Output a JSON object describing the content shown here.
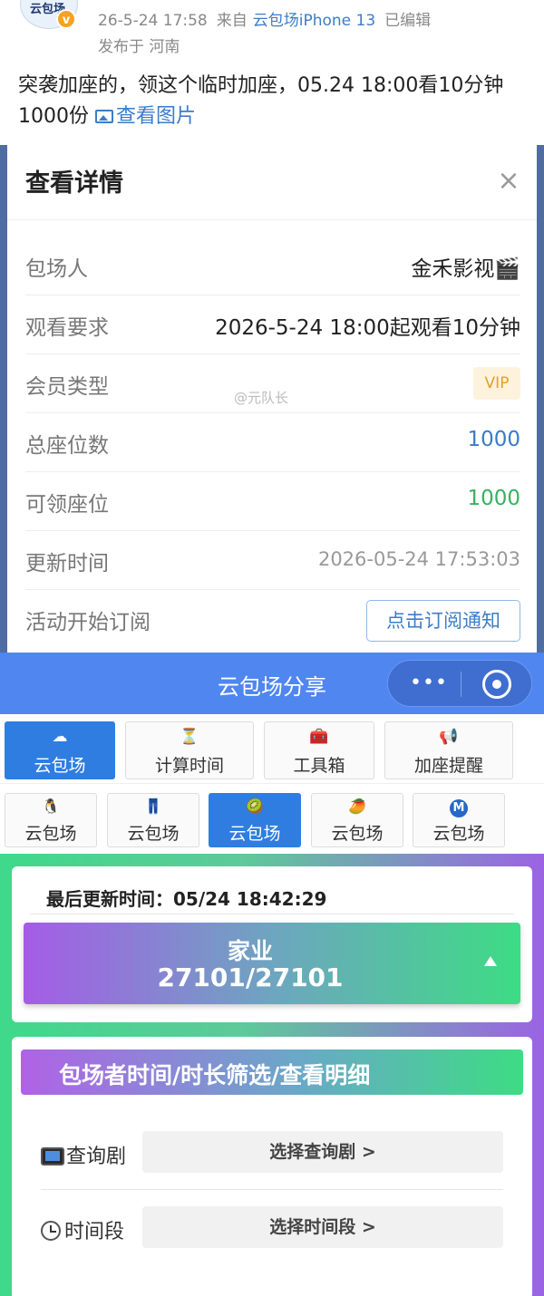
{
  "post": {
    "avatar_text": "云包场",
    "verified_badge": "v",
    "datetime": "26-5-24 17:58",
    "source_prefix": "来自",
    "source_device": "云包场iPhone 13",
    "edited": "已编辑",
    "location": "发布于 河南",
    "body": "突袭加座的，领这个临时加座，05.24 18:00看10分钟 1000份",
    "image_link": "查看图片"
  },
  "modal": {
    "title": "查看详情",
    "close_icon": "×",
    "rows": [
      {
        "label": "包场人",
        "value": "金禾影视🎬"
      },
      {
        "label": "观看要求",
        "value": "2026-5-24 18:00起观看10分钟"
      },
      {
        "label": "会员类型",
        "value": "VIP"
      },
      {
        "label": "总座位数",
        "value": "1000"
      },
      {
        "label": "可领座位",
        "value": "1000"
      },
      {
        "label": "更新时间",
        "value": "2026-05-24 17:53:03"
      },
      {
        "label": "活动开始订阅",
        "value": "点击订阅通知"
      }
    ],
    "watermark": "@元队长",
    "colors": {
      "total_seats": "#3a7bc8",
      "available_seats": "#39b060",
      "vip": "#e3a02a"
    }
  },
  "appbar": {
    "title": "云包场分享",
    "menu_icon": "•••"
  },
  "tabs_main": [
    {
      "label": "云包场",
      "icon": "☁",
      "active": true
    },
    {
      "label": "计算时间",
      "icon": "⏳",
      "active": false
    },
    {
      "label": "工具箱",
      "icon": "🧰",
      "active": false
    },
    {
      "label": "加座提醒",
      "icon": "📢",
      "active": false
    }
  ],
  "tabs_platform": [
    {
      "label": "云包场",
      "icon": "🐧",
      "active": false
    },
    {
      "label": "云包场",
      "icon": "👖",
      "active": false
    },
    {
      "label": "云包场",
      "icon": "🥝",
      "active": true
    },
    {
      "label": "云包场",
      "icon": "🥭",
      "active": false
    },
    {
      "label": "云包场",
      "icon": "M",
      "active": false
    }
  ],
  "stats": {
    "last_updated": "最后更新时间：05/24 18:42:29",
    "name": "家业",
    "count": "27101/27101"
  },
  "filter": {
    "title": "包场者时间/时长筛选/查看明细",
    "drama_label": "查询剧",
    "drama_button": "选择查询剧 >",
    "time_label": "时间段",
    "time_button": "选择时间段 >"
  }
}
